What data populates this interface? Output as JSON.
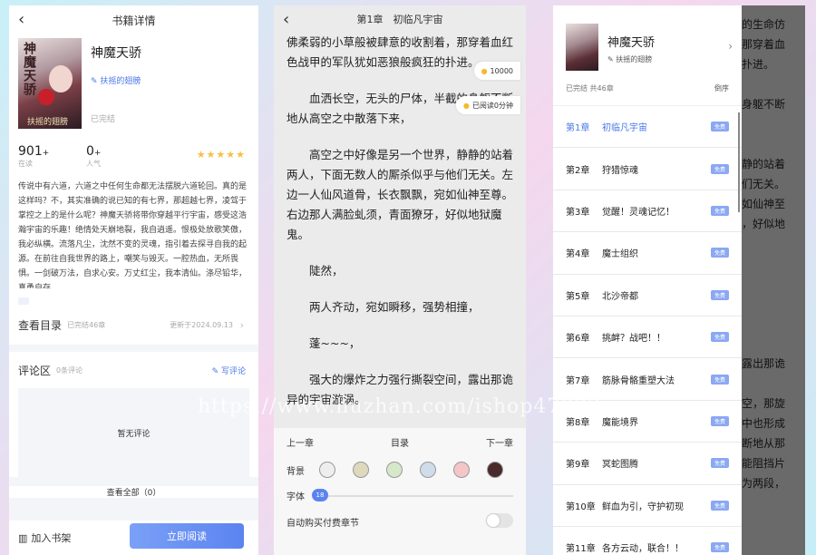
{
  "screen1": {
    "title": "书籍详情",
    "book": {
      "cover_text": "神魔天骄",
      "cover_author": "扶摇的翅膀",
      "title": "神魔天骄",
      "author": "扶摇的翅膀",
      "status": "已完结"
    },
    "stats": [
      {
        "value": "901",
        "suffix": "+",
        "label": "在读"
      },
      {
        "value": "0",
        "suffix": "+",
        "label": "人气"
      }
    ],
    "rating_stars": 5,
    "description": "传说中有六道，六道之中任何生命都无法摆脱六道轮回。真的是这样吗？不，其实准确的说已知的有七界，那超越七界，凌驾于掌控之上的是什么呢？神魔天骄将带你穿越平行宇宙，感受这浩瀚宇宙的乐趣！绝情处天崩地裂，我自逍遥。恨极处放歌笑傲，我必纵横。流落凡尘，沈然不变的灵魂，指引着去探寻自我的起源。在前往自我世界的路上，嘲笑与毁灭。一腔热血，无所畏惧。一剑破万法，自求心安。万丈红尘，我本清仙。涤尽铅华，真勇自存",
    "toc": {
      "label": "查看目录",
      "count": "已完结46章",
      "updated": "更新于2024.09.13"
    },
    "comments": {
      "label": "评论区",
      "count": "0条评论",
      "write": "写评论",
      "empty": "暂无评论",
      "view_all": "查看全部（0）"
    },
    "bottom": {
      "add_shelf": "加入书架",
      "read_now": "立即阅读"
    }
  },
  "screen2": {
    "title": "第1章　初临凡宇宙",
    "paragraphs": [
      "佛柔弱的小草般被肆意的收割着，那穿着血红色战甲的军队犹如恶狼般疯狂的扑进。",
      "血洒长空，无头的尸体，半截的身躯不断地从高空之中散落下来，",
      "高空之中好像是另一个世界，静静的站着两人，下面无数人的厮杀似乎与他们无关。左边一人仙风道骨，长衣飘飘，宛如仙神至尊。右边那人满脸虬须，青面獠牙，好似地狱魔鬼。",
      "陡然，",
      "两人齐动，宛如瞬移，强势相撞，",
      "蓬~~~，",
      "强大的爆炸之力强行撕裂空间，露出那诡异的宇宙漩涡。"
    ],
    "pill_coins": "10000",
    "pill_read": "已阅读0分钟",
    "nav": {
      "prev": "上一章",
      "toc": "目录",
      "next": "下一章"
    },
    "bg_label": "背景",
    "bg_colors": [
      "#eeeeee",
      "#ded9bc",
      "#d5e8c9",
      "#cfdcea",
      "#f4c6c8",
      "#4a2a2a"
    ],
    "font_label": "字体",
    "font_size": "18",
    "auto_buy_label": "自动购买付费章节",
    "auto_buy": false
  },
  "screen3": {
    "book_title": "神魔天骄",
    "author": "扶摇的翅膀",
    "status": "已完结 共46章",
    "order": "倒序",
    "free_badge": "免费",
    "chapters": [
      {
        "num": "第1章",
        "name": "初临凡宇宙"
      },
      {
        "num": "第2章",
        "name": "狩猎惊魂"
      },
      {
        "num": "第3章",
        "name": "觉醒！灵魂记忆！"
      },
      {
        "num": "第4章",
        "name": "魔士组织"
      },
      {
        "num": "第5章",
        "name": "北沙帝都"
      },
      {
        "num": "第6章",
        "name": "挑衅？战吧！！"
      },
      {
        "num": "第7章",
        "name": "筋脉骨骼重塑大法"
      },
      {
        "num": "第8章",
        "name": "魔能境界"
      },
      {
        "num": "第9章",
        "name": "冥蛇图腾"
      },
      {
        "num": "第10章",
        "name": "鲜血为引，守护初现"
      },
      {
        "num": "第11章",
        "name": "各方云动，联合！！"
      }
    ],
    "behind_text": [
      "的生命仿",
      "那穿着血",
      "扑进。",
      "",
      "身躯不断",
      "",
      "",
      "静的站着",
      "们无关。",
      "如仙神至",
      "，好似地",
      "",
      "",
      "",
      "",
      "",
      "",
      "露出那诡",
      "",
      "空，那旋",
      "中也形成",
      "断地从那",
      "能阻挡片",
      "为两段，"
    ]
  },
  "watermark": "https://www.huzhan.com/ishop47032"
}
